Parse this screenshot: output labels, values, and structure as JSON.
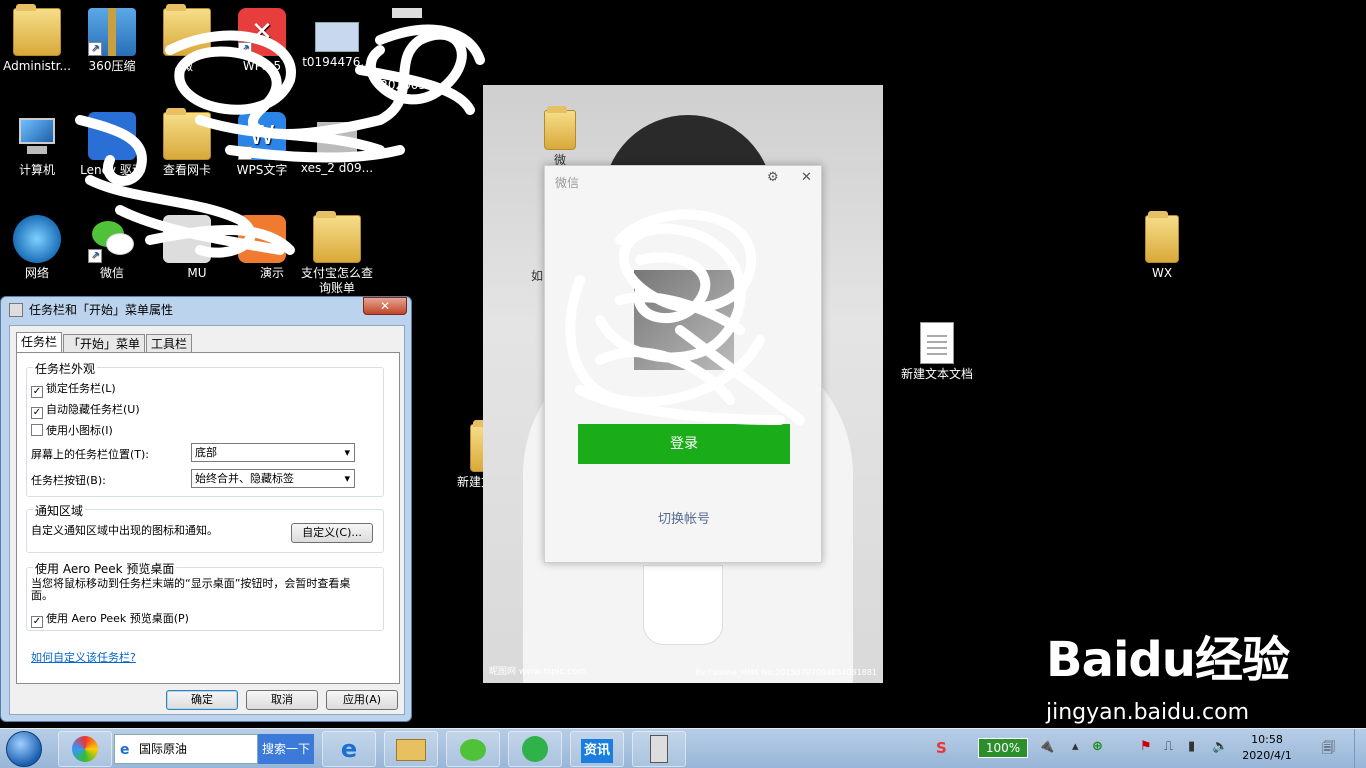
{
  "desktop": {
    "icons": [
      {
        "label": "Administr...",
        "icon": "user-folder-icon"
      },
      {
        "label": "360压缩",
        "icon": "zip-icon"
      },
      {
        "label": "微",
        "icon": "folder-icon"
      },
      {
        "label": "WPS 5",
        "icon": "wps-icon"
      },
      {
        "label": "t0194476...",
        "icon": "image-icon"
      },
      {
        "label": "2020033",
        "icon": "image-icon"
      },
      {
        "label": "计算机",
        "icon": "computer-icon"
      },
      {
        "label": "Lenov 驱动",
        "icon": "lenovo-icon"
      },
      {
        "label": "查看网卡",
        "icon": "folder-icon"
      },
      {
        "label": "WPS文字",
        "icon": "wps-writer-icon"
      },
      {
        "label": "xes_2 d09...",
        "icon": "image-icon"
      },
      {
        "label": "网络",
        "icon": "network-icon"
      },
      {
        "label": "微信",
        "icon": "wechat-icon"
      },
      {
        "label": "MU",
        "icon": "app-icon"
      },
      {
        "label": "演示",
        "icon": "wps-presentation-icon"
      },
      {
        "label": "支付宝怎么查询账单",
        "icon": "folder-icon"
      },
      {
        "label": "WX",
        "icon": "folder-icon"
      },
      {
        "label": "新建文本文档",
        "icon": "text-file-icon"
      },
      {
        "label": "新建文件夹",
        "icon": "folder-icon"
      },
      {
        "label": "微",
        "icon": "folder-icon"
      },
      {
        "label": "如",
        "icon": "folder-icon"
      }
    ]
  },
  "wallpaper_window": {
    "watermark_left": "昵图网 www.nipic.com",
    "watermark_right": "By:Yvonne_HMK No:20150707094834081881"
  },
  "wechat_login": {
    "title": "微信",
    "login_button": "登录",
    "switch_account": "切换帐号"
  },
  "dialog": {
    "title": "任务栏和「开始」菜单属性",
    "close": "✕",
    "tabs": [
      "任务栏",
      "「开始」菜单",
      "工具栏"
    ],
    "appearance_group": "任务栏外观",
    "lock_taskbar": "锁定任务栏(L)",
    "auto_hide": "自动隐藏任务栏(U)",
    "small_icons": "使用小图标(I)",
    "position_label": "屏幕上的任务栏位置(T):",
    "position_value": "底部",
    "buttons_label": "任务栏按钮(B):",
    "buttons_value": "始终合并、隐藏标签",
    "notify_group": "通知区域",
    "notify_text": "自定义通知区域中出现的图标和通知。",
    "customize_button": "自定义(C)...",
    "aero_group": "使用 Aero Peek 预览桌面",
    "aero_text": "当您将鼠标移动到任务栏末端的“显示桌面”按钮时，会暂时查看桌面。",
    "aero_checkbox": "使用 Aero Peek 预览桌面(P)",
    "help_link": "如何自定义该任务栏?",
    "ok": "确定",
    "cancel": "取消",
    "apply": "应用(A)",
    "checked": {
      "lock": true,
      "autohide": true,
      "small": false,
      "aero": true
    }
  },
  "taskbar": {
    "search_text": "国际原油",
    "search_button": "搜索一下",
    "news_button": "资讯",
    "battery": "100%",
    "time": "10:58",
    "date": "2020/4/1"
  },
  "watermark": {
    "brand": "Baidu经验",
    "url": "jingyan.baidu.com"
  }
}
